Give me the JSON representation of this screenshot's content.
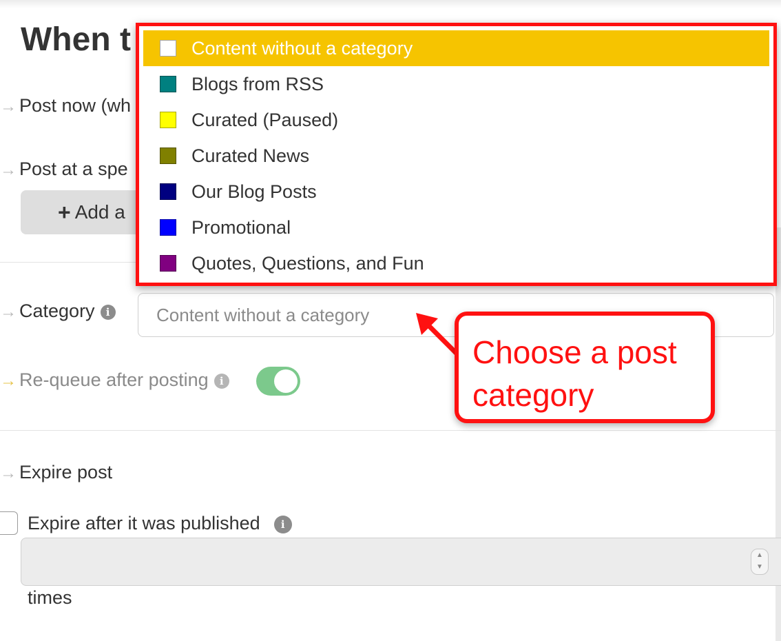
{
  "page": {
    "heading": "When t",
    "post_now_label": "Post now (wh",
    "post_specific_label": "Post at a spe",
    "add_button_label": "Add a",
    "category_label": "Category",
    "category_value": "Content without a category",
    "requeue_label": "Re-queue after posting",
    "requeue_enabled": true,
    "expire_label": "Expire post",
    "expire_after_label": "Expire after it was published",
    "times_label": "times"
  },
  "dropdown": {
    "items": [
      {
        "label": "Content without a category",
        "color": "#ffffff",
        "selected": true
      },
      {
        "label": "Blogs from RSS",
        "color": "#008080",
        "selected": false
      },
      {
        "label": "Curated (Paused)",
        "color": "#ffff00",
        "selected": false
      },
      {
        "label": "Curated News",
        "color": "#808000",
        "selected": false
      },
      {
        "label": "Our Blog Posts",
        "color": "#000080",
        "selected": false
      },
      {
        "label": "Promotional",
        "color": "#0000ff",
        "selected": false
      },
      {
        "label": "Quotes, Questions, and Fun",
        "color": "#800080",
        "selected": false
      }
    ]
  },
  "callout": {
    "text": "Choose a post category"
  },
  "colors": {
    "highlight": "#f6c400",
    "annotation": "#ff1111",
    "toggle_on": "#7cc98c"
  }
}
